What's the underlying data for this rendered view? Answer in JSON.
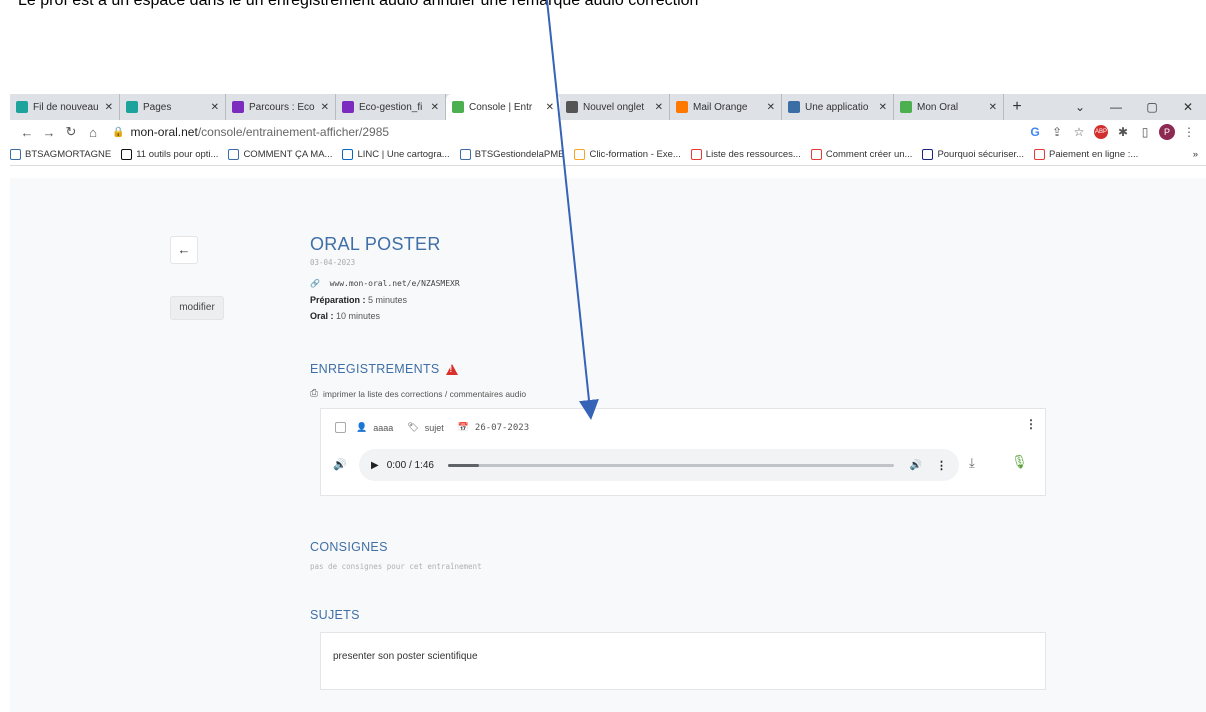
{
  "caption": "Le prof est a un espace dans le un enregistrement audio annuler une remarque audio correction",
  "tabs": [
    {
      "label": "Fil de nouveau",
      "icon": "pages-icon",
      "color": "#1ba39c"
    },
    {
      "label": "Pages",
      "icon": "pages-icon",
      "color": "#1ba39c"
    },
    {
      "label": "Parcours : Eco",
      "icon": "m-logo-icon",
      "color": "#7b2cbf"
    },
    {
      "label": "Eco-gestion_fi",
      "icon": "m-logo-icon",
      "color": "#7b2cbf"
    },
    {
      "label": "Console | Entr",
      "icon": "leaf-icon",
      "color": "#4caf50",
      "active": true
    },
    {
      "label": "Nouvel onglet",
      "icon": "chrome-icon",
      "color": "#555555"
    },
    {
      "label": "Mail Orange",
      "icon": "mail-icon",
      "color": "#ff7900"
    },
    {
      "label": "Une applicatio",
      "icon": "app-icon",
      "color": "#3a6ea5"
    },
    {
      "label": "Mon Oral",
      "icon": "leaf-icon",
      "color": "#4caf50"
    }
  ],
  "address": {
    "host": "mon-oral.net",
    "path": "/console/entrainement-afficher/2985"
  },
  "bookmarks": [
    {
      "label": "BTSAGMORTAGNE",
      "icon": "grid-icon",
      "color": "#3a6ea5"
    },
    {
      "label": "11 outils pour opti...",
      "icon": "ms-icon",
      "color": "#111111"
    },
    {
      "label": "COMMENT ÇA MA...",
      "icon": "wave-icon",
      "color": "#3a6ea5"
    },
    {
      "label": "LINC | Une cartogra...",
      "icon": "linkedin-icon",
      "color": "#0a66c2"
    },
    {
      "label": "BTSGestiondelaPME",
      "icon": "grid-icon",
      "color": "#3a6ea5"
    },
    {
      "label": "Clic-formation - Exe...",
      "icon": "circle-icon",
      "color": "#f5a623"
    },
    {
      "label": "Liste des ressources...",
      "icon": "bracket-icon",
      "color": "#e53935"
    },
    {
      "label": "Comment créer un...",
      "icon": "bracket-icon",
      "color": "#e53935"
    },
    {
      "label": "Pourquoi sécuriser...",
      "icon": "c-icon",
      "color": "#1a237e"
    },
    {
      "label": "Paiement en ligne :...",
      "icon": "bracket-icon",
      "color": "#e53935"
    }
  ],
  "page": {
    "back_label": "←",
    "modify_label": "modifier",
    "title": "ORAL POSTER",
    "date": "03-04-2023",
    "link": "www.mon-oral.net/e/NZASMEXR",
    "prep_label": "Préparation :",
    "prep_value": " 5 minutes",
    "oral_label": "Oral :",
    "oral_value": " 10 minutes",
    "recordings_title": "ENREGISTREMENTS",
    "print_label": "imprimer la liste des corrections / commentaires audio",
    "recording": {
      "user": "aaaa",
      "tag": "sujet",
      "date": "26-07-2023",
      "time": "0:00 / 1:46",
      "progress": 0.07
    },
    "consignes_title": "CONSIGNES",
    "consignes_text": "pas de consignes pour cet entraînement",
    "sujets_title": "SUJETS",
    "sujet_text": "presenter son poster scientifique"
  }
}
